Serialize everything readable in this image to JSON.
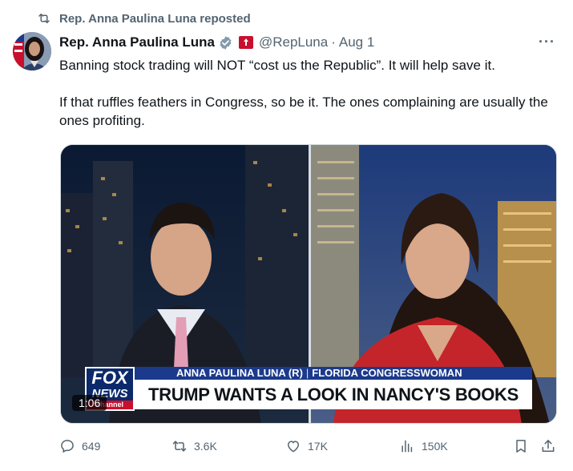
{
  "repost": {
    "label": "Rep. Anna Paulina Luna reposted"
  },
  "tweet": {
    "author_name": "Rep. Anna Paulina Luna",
    "handle": "@RepLuna",
    "separator": "·",
    "date": "Aug 1",
    "more_label": "···",
    "paragraphs": [
      "Banning stock trading will NOT “cost us the Republic”. It will help save it.",
      "If that ruffles feathers in Congress, so be it. The ones complaining are usually the ones profiting."
    ]
  },
  "video": {
    "timecode": "1:06",
    "lower_third_name": "ANNA PAULINA LUNA (R)",
    "lower_third_title": "FLORIDA CONGRESSWOMAN",
    "lower_third_sep": "|",
    "headline": "TRUMP WANTS A LOOK IN NANCY'S BOOKS",
    "network_logo_line1": "FOX",
    "network_logo_line2": "NEWS",
    "network_logo_line3": "channel"
  },
  "actions": {
    "replies": "649",
    "reposts": "3.6K",
    "likes": "17K",
    "views": "150K"
  },
  "colors": {
    "text_primary": "#0f1419",
    "text_secondary": "#536471",
    "verified_badge": "#829aab",
    "flag_red": "#c8102e",
    "fox_blue": "#0c2a6b",
    "lower_third_blue": "#1b3a8c"
  },
  "icons": {
    "repost": "repost-icon",
    "verified": "verified-badge-icon",
    "affiliation": "flag-icon",
    "reply": "reply-icon",
    "retweet": "retweet-icon",
    "like": "heart-icon",
    "views": "views-icon",
    "bookmark": "bookmark-icon",
    "share": "share-icon"
  }
}
